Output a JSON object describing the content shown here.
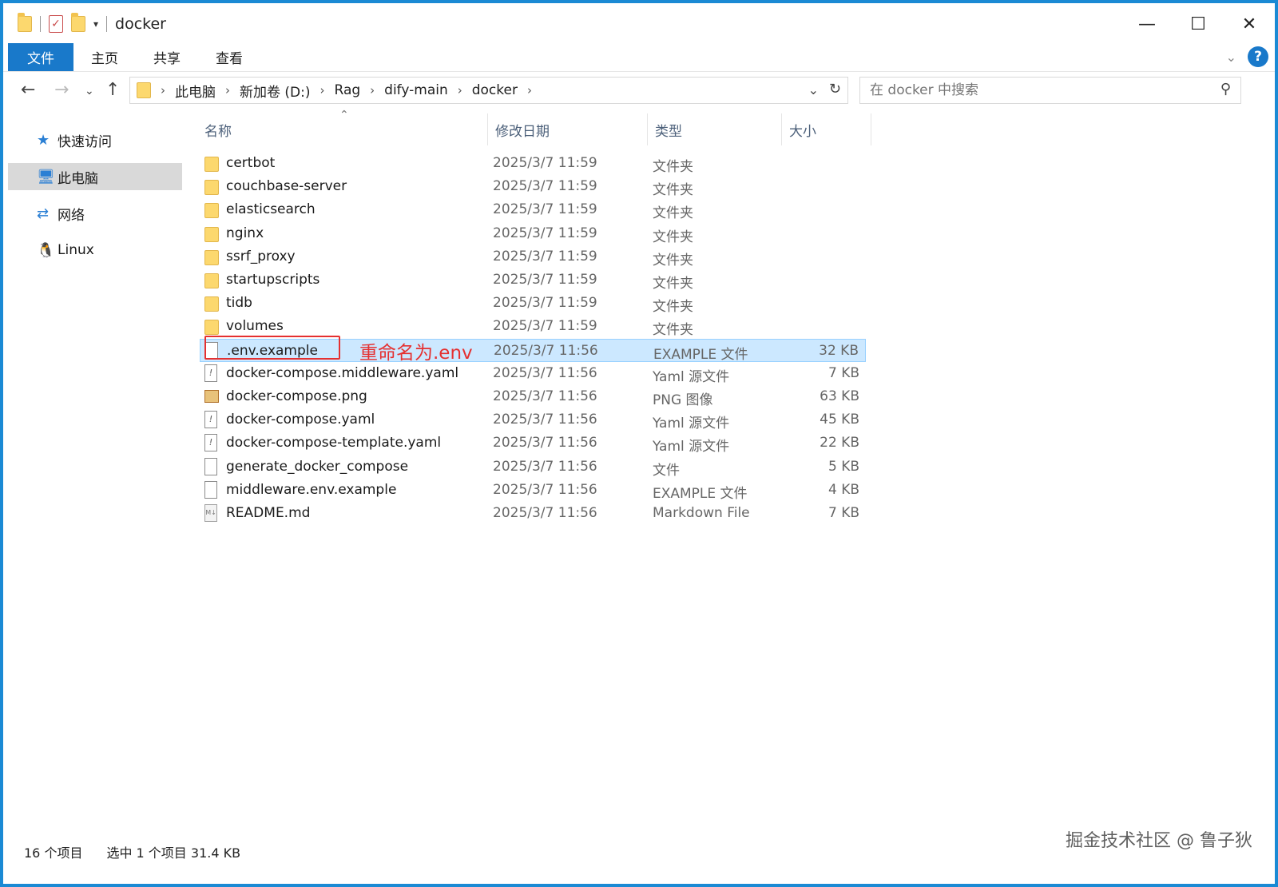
{
  "title": "docker",
  "window_controls": {
    "minimize": "—",
    "maximize": "☐",
    "close": "✕"
  },
  "ribbon": {
    "tabs": [
      "文件",
      "主页",
      "共享",
      "查看"
    ]
  },
  "breadcrumb": [
    "此电脑",
    "新加卷 (D:)",
    "Rag",
    "dify-main",
    "docker"
  ],
  "search": {
    "placeholder": "在 docker 中搜索"
  },
  "sidebar": {
    "items": [
      {
        "label": "快速访问",
        "icon": "star-icon"
      },
      {
        "label": "此电脑",
        "icon": "computer-icon",
        "active": true
      },
      {
        "label": "网络",
        "icon": "network-icon"
      },
      {
        "label": "Linux",
        "icon": "penguin-icon"
      }
    ]
  },
  "columns": {
    "name": "名称",
    "date": "修改日期",
    "type": "类型",
    "size": "大小"
  },
  "files": [
    {
      "name": "certbot",
      "date": "2025/3/7 11:59",
      "type": "文件夹",
      "size": "",
      "icon": "folder"
    },
    {
      "name": "couchbase-server",
      "date": "2025/3/7 11:59",
      "type": "文件夹",
      "size": "",
      "icon": "folder"
    },
    {
      "name": "elasticsearch",
      "date": "2025/3/7 11:59",
      "type": "文件夹",
      "size": "",
      "icon": "folder"
    },
    {
      "name": "nginx",
      "date": "2025/3/7 11:59",
      "type": "文件夹",
      "size": "",
      "icon": "folder"
    },
    {
      "name": "ssrf_proxy",
      "date": "2025/3/7 11:59",
      "type": "文件夹",
      "size": "",
      "icon": "folder"
    },
    {
      "name": "startupscripts",
      "date": "2025/3/7 11:59",
      "type": "文件夹",
      "size": "",
      "icon": "folder"
    },
    {
      "name": "tidb",
      "date": "2025/3/7 11:59",
      "type": "文件夹",
      "size": "",
      "icon": "folder"
    },
    {
      "name": "volumes",
      "date": "2025/3/7 11:59",
      "type": "文件夹",
      "size": "",
      "icon": "folder"
    },
    {
      "name": ".env.example",
      "date": "2025/3/7 11:56",
      "type": "EXAMPLE 文件",
      "size": "32 KB",
      "icon": "doc",
      "selected": true
    },
    {
      "name": "docker-compose.middleware.yaml",
      "date": "2025/3/7 11:56",
      "type": "Yaml 源文件",
      "size": "7 KB",
      "icon": "yaml"
    },
    {
      "name": "docker-compose.png",
      "date": "2025/3/7 11:56",
      "type": "PNG 图像",
      "size": "63 KB",
      "icon": "png"
    },
    {
      "name": "docker-compose.yaml",
      "date": "2025/3/7 11:56",
      "type": "Yaml 源文件",
      "size": "45 KB",
      "icon": "yaml"
    },
    {
      "name": "docker-compose-template.yaml",
      "date": "2025/3/7 11:56",
      "type": "Yaml 源文件",
      "size": "22 KB",
      "icon": "yaml"
    },
    {
      "name": "generate_docker_compose",
      "date": "2025/3/7 11:56",
      "type": "文件",
      "size": "5 KB",
      "icon": "doc"
    },
    {
      "name": "middleware.env.example",
      "date": "2025/3/7 11:56",
      "type": "EXAMPLE 文件",
      "size": "4 KB",
      "icon": "doc"
    },
    {
      "name": "README.md",
      "date": "2025/3/7 11:56",
      "type": "Markdown File",
      "size": "7 KB",
      "icon": "md"
    }
  ],
  "annotation": "重命名为.env",
  "status": {
    "count": "16 个项目",
    "selection": "选中 1 个项目  31.4 KB"
  },
  "watermark": "掘金技术社区 @ 鲁子狄",
  "colors": {
    "accent": "#1979ca",
    "selection": "#cce8ff",
    "annotation": "#e53030",
    "folder": "#fcd86e"
  }
}
